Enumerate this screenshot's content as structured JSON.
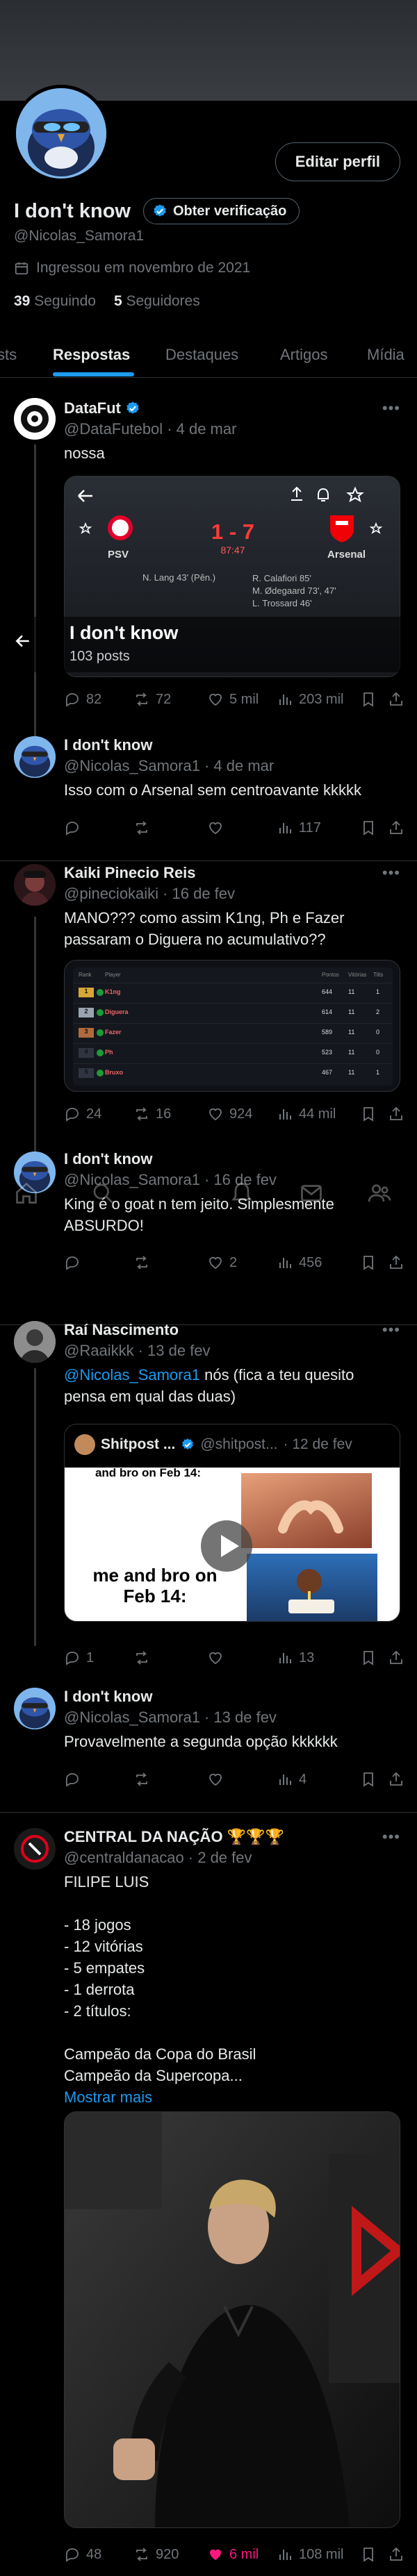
{
  "profile": {
    "display_name": "I don't know",
    "handle": "@Nicolas_Samora1",
    "edit_label": "Editar perfil",
    "verify_label": "Obter verificação",
    "joined": "Ingressou em novembro de 2021",
    "following_count": "39",
    "following_label": "Seguindo",
    "followers_count": "5",
    "followers_label": "Seguidores"
  },
  "tabs": [
    {
      "label": "sts"
    },
    {
      "label": "Respostas"
    },
    {
      "label": "Destaques"
    },
    {
      "label": "Artigos"
    },
    {
      "label": "Mídia"
    }
  ],
  "mini_header": {
    "title": "I don't know",
    "subtitle": "103 posts"
  },
  "posts": [
    {
      "name": "DataFut",
      "handle": "@DataFutebol",
      "date": "· 4 de mar",
      "text": "nossa",
      "card": {
        "score": "1 - 7",
        "minute": "87:47",
        "home": "PSV",
        "away": "Arsenal",
        "home_scorer": "N. Lang 43' (Pên.)",
        "away_scorers": [
          "R. Calafiori 85'",
          "M. Ødegaard 73', 47'",
          "L. Trossard 46'"
        ]
      },
      "stats": {
        "replies": "82",
        "reposts": "72",
        "likes": "5 mil",
        "views": "203 mil"
      }
    },
    {
      "name": "I don't know",
      "handle": "@Nicolas_Samora1",
      "date": "· 4 de mar",
      "text": "Isso com o Arsenal sem centroavante kkkkk",
      "stats": {
        "replies": "",
        "reposts": "",
        "likes": "",
        "views": "117"
      }
    },
    {
      "name": "Kaiki Pinecio Reis",
      "handle": "@pineciokaiki",
      "date": "· 16 de fev",
      "text": "MANO??? como assim K1ng, Ph e Fazer passaram o Diguera no acumulativo??",
      "table": {
        "headers": [
          "Rank",
          "Player",
          "Pontos",
          "Vitórias",
          "Tilts"
        ],
        "rows": [
          {
            "rank": "1",
            "player": "K1ng",
            "pts": "644",
            "w": "11",
            "t": "1"
          },
          {
            "rank": "2",
            "player": "Diguera",
            "pts": "614",
            "w": "11",
            "t": "2"
          },
          {
            "rank": "3",
            "player": "Fazer",
            "pts": "589",
            "w": "11",
            "t": "0"
          },
          {
            "rank": "4",
            "player": "Ph",
            "pts": "523",
            "w": "11",
            "t": "0"
          },
          {
            "rank": "5",
            "player": "Bruxo",
            "pts": "467",
            "w": "11",
            "t": "1"
          }
        ]
      },
      "stats": {
        "replies": "24",
        "reposts": "16",
        "likes": "924",
        "views": "44 mil"
      }
    },
    {
      "name": "I don't know",
      "handle": "@Nicolas_Samora1",
      "date": "· 16 de fev",
      "text": "King é o goat n tem jeito. Simplesmente ABSURDO!",
      "stats": {
        "replies": "",
        "reposts": "",
        "likes": "2",
        "views": "456"
      }
    },
    {
      "name": "Raí Nascimento",
      "handle": "@Raaikkk",
      "date": "· 13 de fev",
      "mention": "@Nicolas_Samora1",
      "text": " nós (fica a teu quesito pensa em qual das duas)",
      "quote": {
        "name": "Shitpost ...",
        "handle": "@shitpost...",
        "date": "· 12 de fev",
        "caption_top": "and bro on Feb 14:",
        "caption": "me and bro on Feb 14:"
      },
      "stats": {
        "replies": "1",
        "reposts": "",
        "likes": "",
        "views": "13"
      }
    },
    {
      "name": "I don't know",
      "handle": "@Nicolas_Samora1",
      "date": "· 13 de fev",
      "text": "Provavelmente a segunda opção kkkkkk",
      "stats": {
        "replies": "",
        "reposts": "",
        "likes": "",
        "views": "4"
      }
    },
    {
      "name": "CENTRAL DA NAÇÃO 🏆🏆🏆",
      "handle": "@centraldanacao",
      "date": "· 2 de fev",
      "lines": [
        "FILIPE LUIS",
        "",
        "- 18 jogos",
        "- 12 vitórias",
        "- 5 empates",
        "- 1 derrota",
        "- 2 títulos:",
        "",
        "Campeão da Copa do Brasil",
        "Campeão da Supercopa..."
      ],
      "show_more": "Mostrar mais",
      "stats": {
        "replies": "48",
        "reposts": "920",
        "likes": "6 mil",
        "views": "108 mil"
      }
    }
  ],
  "colors": {
    "accent": "#1d9bf0",
    "like": "#f91880",
    "muted": "#71767b",
    "border": "#2f3336"
  }
}
